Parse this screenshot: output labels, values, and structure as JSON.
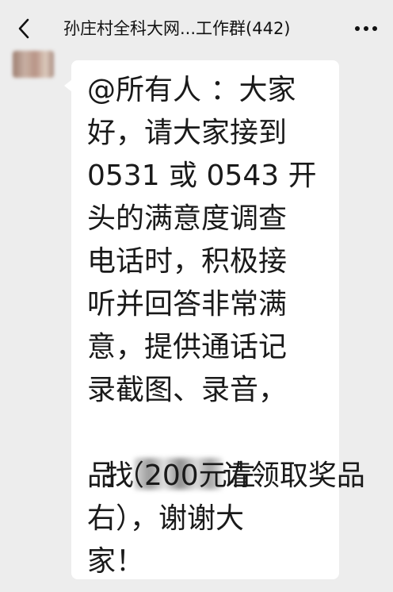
{
  "header": {
    "title": "孙庄村全科大网...工作群(442)",
    "back_icon": "chevron-left-icon",
    "more_icon": "more-horizontal-icon"
  },
  "message": {
    "lines": [
      "@所有人 ：大家",
      "好，请大家接到",
      "0531 或 0543 开",
      "头的满意度调查",
      "电话时，积极接",
      "听并回答非常满",
      "意，提供通话记",
      "录截图、录音，",
      "找",
      "请领取奖品",
      "品（200元左",
      "右），谢谢大",
      "家！"
    ]
  },
  "colors": {
    "background": "#ededed",
    "bubble": "#ffffff",
    "text": "#1a1a1a"
  }
}
